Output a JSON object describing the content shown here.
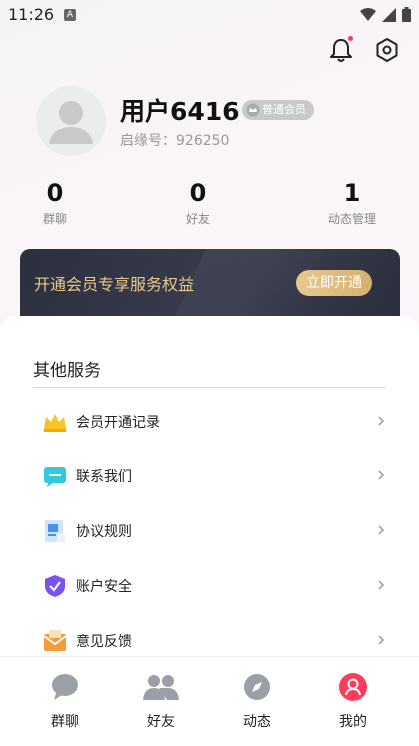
{
  "status_bar": {
    "time": "11:26",
    "a_icon": "A"
  },
  "profile": {
    "name": "用户6416",
    "badge": "普通会员",
    "uid_label": "启缘号：",
    "uid_value": "926250"
  },
  "stats": [
    {
      "value": "0",
      "label": "群聊"
    },
    {
      "value": "0",
      "label": "好友"
    },
    {
      "value": "1",
      "label": "动态管理"
    }
  ],
  "vip": {
    "text": "开通会员专享服务权益",
    "button": "立即开通"
  },
  "services": {
    "title": "其他服务",
    "items": [
      {
        "label": "会员开通记录",
        "icon": "crown-icon"
      },
      {
        "label": "联系我们",
        "icon": "chat-icon"
      },
      {
        "label": "协议规则",
        "icon": "document-icon"
      },
      {
        "label": "账户安全",
        "icon": "shield-icon"
      },
      {
        "label": "意见反馈",
        "icon": "mail-icon"
      }
    ]
  },
  "tabbar": [
    {
      "label": "群聊",
      "icon": "chat-bubble-icon"
    },
    {
      "label": "好友",
      "icon": "friends-icon"
    },
    {
      "label": "动态",
      "icon": "compass-icon"
    },
    {
      "label": "我的",
      "icon": "user-icon",
      "active": true
    }
  ],
  "colors": {
    "accent": "#ff3b5c",
    "vip_gold": "#e9c98a",
    "vip_bg": "#2c2f3e"
  }
}
